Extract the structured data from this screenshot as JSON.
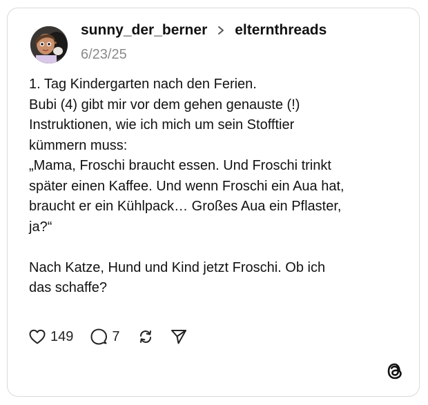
{
  "post": {
    "author": {
      "username": "sunny_der_berner",
      "avatar": "avatar-photo-child-and-dog"
    },
    "community": "elternthreads",
    "date": "6/23/25",
    "body": "1. Tag Kindergarten nach den Ferien.\nBubi (4) gibt mir vor dem gehen genauste (!)\nInstruktionen, wie ich mich um sein Stofftier\nkümmern muss:\n„Mama, Froschi braucht essen. Und Froschi trinkt\nspäter einen Kaffee. Und wenn Froschi ein Aua hat,\nbraucht er ein Kühlpack… Großes Aua ein Pflaster,\nja?“\n\nNach Katze, Hund und Kind jetzt Froschi. Ob ich\ndas schaffe?",
    "actions": {
      "like": {
        "icon": "heart-icon",
        "count": "149"
      },
      "reply": {
        "icon": "comment-icon",
        "count": "7"
      },
      "repost": {
        "icon": "repost-icon"
      },
      "share": {
        "icon": "send-icon"
      }
    }
  },
  "footer": {
    "logo": "threads-logo-icon"
  },
  "colors": {
    "text": "#111111",
    "muted": "#8a8a8a",
    "border": "#d9d9d9",
    "background": "#ffffff"
  }
}
